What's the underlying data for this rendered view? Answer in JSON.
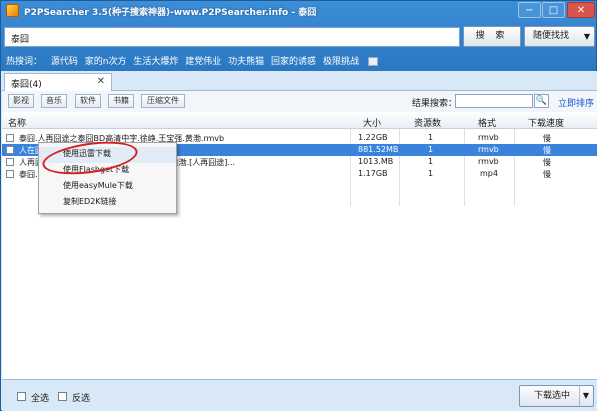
{
  "window": {
    "title": "P2PSearcher 3.5(种子搜索神器)-www.P2PSearcher.info - 泰囧",
    "min_label": "−",
    "max_label": "□",
    "close_label": "✕"
  },
  "search": {
    "value": "泰囧",
    "search_button": "搜 索",
    "random_button": "随便找找"
  },
  "hot": {
    "label": "热搜词：",
    "words": [
      "源代码",
      "家的n次方",
      "生活大爆炸",
      "建党伟业",
      "功夫熊猫",
      "回家的诱惑",
      "极限挑战"
    ]
  },
  "tab": {
    "label": "泰囧(4)",
    "close": "✕"
  },
  "filters": {
    "buttons": [
      "影视",
      "音乐",
      "软件",
      "书籍",
      "压缩文件"
    ],
    "result_search_label": "结果搜索：",
    "search_glyph": "🔍",
    "sort_link": "立即排序"
  },
  "table": {
    "headers": [
      "名称",
      "大小",
      "资源数",
      "格式",
      "下载速度"
    ],
    "rows": [
      {
        "name": "泰囧.人再囧途之泰囧BD高清中字.徐峥.王宝强.黄渤.rmvb",
        "size": "1.22GB",
        "sources": "1",
        "format": "rmvb",
        "speed": "慢",
        "selected": false
      },
      {
        "name": "人在囧途之泰囧.rmvb",
        "size": "881.52MB",
        "sources": "1",
        "format": "rmvb",
        "speed": "慢",
        "selected": true
      },
      {
        "name": "人再囧途之泰囧国语中英双字.徐峥.王宝强.黄渤.[人再囧途]...",
        "size": "1013.MB",
        "sources": "1",
        "format": "rmvb",
        "speed": "慢",
        "selected": false
      },
      {
        "name": "泰囧.mp4",
        "size": "1.17GB",
        "sources": "1",
        "format": "mp4",
        "speed": "慢",
        "selected": false
      }
    ]
  },
  "context_menu": {
    "items": [
      "使用迅雷下载",
      "使用Flashget下载",
      "使用easyMule下载",
      "复制ED2K链接"
    ]
  },
  "bottom": {
    "select_all": "全选",
    "invert": "反选",
    "download_selected": "下载选中",
    "download_arrow": "▼"
  }
}
